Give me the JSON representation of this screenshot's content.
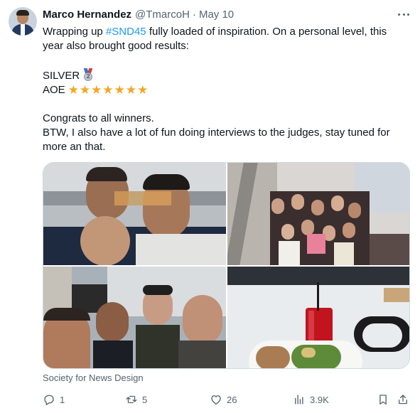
{
  "tweet": {
    "author_name": "Marco Hernandez",
    "author_handle": "@TmarcoH",
    "separator": "·",
    "date": "May 10",
    "text": {
      "line1_before": "Wrapping up ",
      "hashtag": "#SND45",
      "line1_after": " fully loaded of inspiration. On a personal level, this",
      "line2": "year also brought good results:",
      "silver": "SILVER",
      "medal_number": "2",
      "aoe": "AOE",
      "stars": "★★★★★★★",
      "congrats": "Congrats to all winners.",
      "btw_line1": "BTW, I also have a lot of fun doing interviews to the judges, stay tuned for",
      "btw_line2": "more an that."
    },
    "media_source": "Society for News Design",
    "stats": {
      "replies": "1",
      "reposts": "5",
      "likes": "26",
      "views": "3.9K"
    }
  },
  "icons": [
    "more-icon",
    "reply-icon",
    "repost-icon",
    "like-icon",
    "views-icon",
    "bookmark-icon",
    "share-icon"
  ],
  "colors": {
    "link": "#1d9bf0",
    "text": "#0f1419",
    "secondary": "#536471",
    "border": "#cfd9de",
    "star": "#f5a623"
  }
}
